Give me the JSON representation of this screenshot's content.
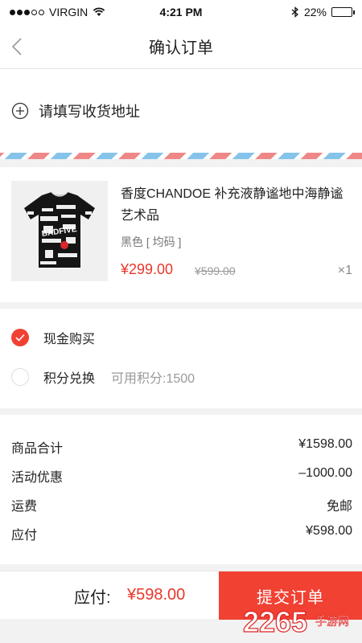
{
  "status": {
    "carrier": "VIRGIN",
    "time": "4:21 PM",
    "battery": "22%"
  },
  "nav": {
    "title": "确认订单"
  },
  "address": {
    "label": "请填写收货地址"
  },
  "product": {
    "name": "香度CHANDOE 补充液静谧地中海静谧艺术品",
    "spec": "黑色 [ 均码 ]",
    "price": "¥299.00",
    "original_price": "¥599.00",
    "quantity": "×1",
    "image_text": "BADFIVE"
  },
  "payment": {
    "cash": {
      "label": "现金购买",
      "selected": true
    },
    "points": {
      "label": "积分兑换",
      "sub": "可用积分:1500",
      "selected": false
    }
  },
  "summary": {
    "rows": [
      {
        "label": "商品合计",
        "value": "¥1598.00"
      },
      {
        "label": "活动优惠",
        "value": "–1000.00"
      },
      {
        "label": "运费",
        "value": "免邮"
      },
      {
        "label": "应付",
        "value": "¥598.00"
      }
    ]
  },
  "bottom": {
    "total_label": "应付:",
    "total_value": "¥598.00",
    "submit": "提交订单"
  },
  "watermark": {
    "brand": "2265",
    "suffix": "手游网"
  },
  "colors": {
    "accent": "#f04133"
  }
}
